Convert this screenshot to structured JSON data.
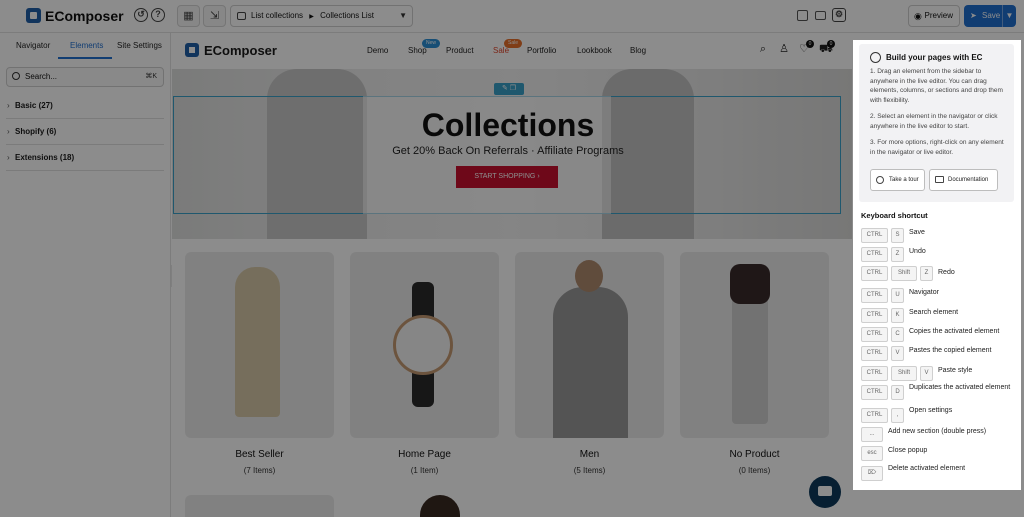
{
  "app": {
    "name": "EComposer",
    "page_select": "List collections",
    "page_select_sub": "Collections List",
    "preview_label": "Preview",
    "save_label": "Save"
  },
  "left_panel": {
    "tabs": [
      "Navigator",
      "Elements",
      "Site Settings"
    ],
    "search_placeholder": "Search...",
    "search_shortcut": "⌘K",
    "categories": [
      "Basic (27)",
      "Shopify (6)",
      "Extensions (18)"
    ]
  },
  "store": {
    "brand": "EComposer",
    "nav": [
      "Demo",
      "Shop",
      "Product",
      "Sale",
      "Portfolio",
      "Lookbook",
      "Blog"
    ],
    "badges": {
      "shop": "New",
      "sale": "Sale"
    },
    "counts": {
      "wishlist": "0",
      "cart": "0"
    },
    "hero": {
      "title": "Collections",
      "subtitle": "Get 20% Back On Referrals · Affiliate Programs",
      "button": "START SHOPPING"
    },
    "collections": [
      {
        "title": "Best Seller",
        "count": "(7 Items)"
      },
      {
        "title": "Home Page",
        "count": "(1 Item)"
      },
      {
        "title": "Men",
        "count": "(5 Items)"
      },
      {
        "title": "No Product",
        "count": "(0 Items)"
      }
    ]
  },
  "popup": {
    "title": "Build your pages with EC",
    "tips": [
      "1. Drag an element from the sidebar to anywhere in the live editor. You can drag elements, columns, or sections and drop them with flexibility.",
      "2. Select an element in the navigator or click anywhere in the live editor to start.",
      "3. For more options, right-click on any element in the navigator or live editor."
    ],
    "tour_label": "Take a tour",
    "docs_label": "Documentation",
    "shortcut_title": "Keyboard shortcut",
    "shortcuts": [
      {
        "keys": [
          "CTRL",
          "S"
        ],
        "label": "Save"
      },
      {
        "keys": [
          "CTRL",
          "Z"
        ],
        "label": "Undo"
      },
      {
        "keys": [
          "CTRL",
          "Shift",
          "Z"
        ],
        "label": "Redo"
      },
      {
        "keys": [
          "CTRL",
          "U"
        ],
        "label": "Navigator"
      },
      {
        "keys": [
          "CTRL",
          "K"
        ],
        "label": "Search element"
      },
      {
        "keys": [
          "CTRL",
          "C"
        ],
        "label": "Copies the activated element"
      },
      {
        "keys": [
          "CTRL",
          "V"
        ],
        "label": "Pastes the copied element"
      },
      {
        "keys": [
          "CTRL",
          "Shift",
          "V"
        ],
        "label": "Paste style"
      },
      {
        "keys": [
          "CTRL",
          "D"
        ],
        "label": "Duplicates the activated element"
      },
      {
        "keys": [
          "CTRL",
          ","
        ],
        "label": "Open settings"
      },
      {
        "keys": [
          "..."
        ],
        "label": "Add new section (double press)"
      },
      {
        "keys": [
          "esc"
        ],
        "label": "Close popup"
      },
      {
        "keys": [
          "⌦"
        ],
        "label": "Delete activated element"
      }
    ]
  }
}
